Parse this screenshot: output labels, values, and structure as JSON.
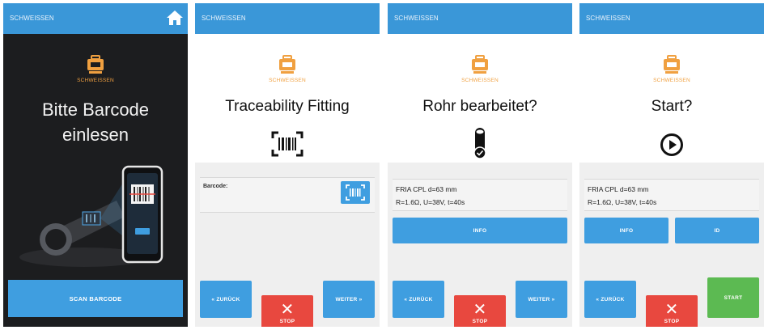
{
  "brand": {
    "accent": "#3a97d8",
    "button": "#3f9ee0",
    "stop": "#e8483f",
    "start": "#5cba52",
    "logo": "#f0a040"
  },
  "screens": [
    {
      "appbar_title": "SCHWEISSEN",
      "home_icon": "home-icon",
      "logo_icon": "welding-machine-icon",
      "logo_label": "SCHWEISSEN",
      "headline_line1": "Bitte Barcode",
      "headline_line2": "einlesen",
      "illustration": "pipe-and-phone-scan-illustration",
      "scan_button": "SCAN BARCODE"
    },
    {
      "appbar_title": "SCHWEISSEN",
      "logo_icon": "welding-machine-icon",
      "logo_label": "SCHWEISSEN",
      "headline": "Traceability Fitting",
      "center_icon": "barcode-scan-icon",
      "barcode_label": "Barcode:",
      "barcode_value": "",
      "back_button": "« ZURÜCK",
      "stop_button": "STOP",
      "next_button": "WEITER »"
    },
    {
      "appbar_title": "SCHWEISSEN",
      "logo_icon": "welding-machine-icon",
      "logo_label": "SCHWEISSEN",
      "headline": "Rohr bearbeitet?",
      "center_icon": "pipe-check-icon",
      "info_line1": "FRIA CPL d=63 mm",
      "info_line2": "R=1.6Ω, U=38V, t=40s",
      "info_button": "INFO",
      "back_button": "« ZURÜCK",
      "stop_button": "STOP",
      "next_button": "WEITER »"
    },
    {
      "appbar_title": "SCHWEISSEN",
      "logo_icon": "welding-machine-icon",
      "logo_label": "SCHWEISSEN",
      "headline": "Start?",
      "center_icon": "play-circle-icon",
      "info_line1": "FRIA CPL d=63 mm",
      "info_line2": "R=1.6Ω, U=38V, t=40s",
      "info_button": "INFO",
      "id_button": "ID",
      "back_button": "« ZURÜCK",
      "stop_button": "STOP",
      "start_button": "START"
    }
  ]
}
